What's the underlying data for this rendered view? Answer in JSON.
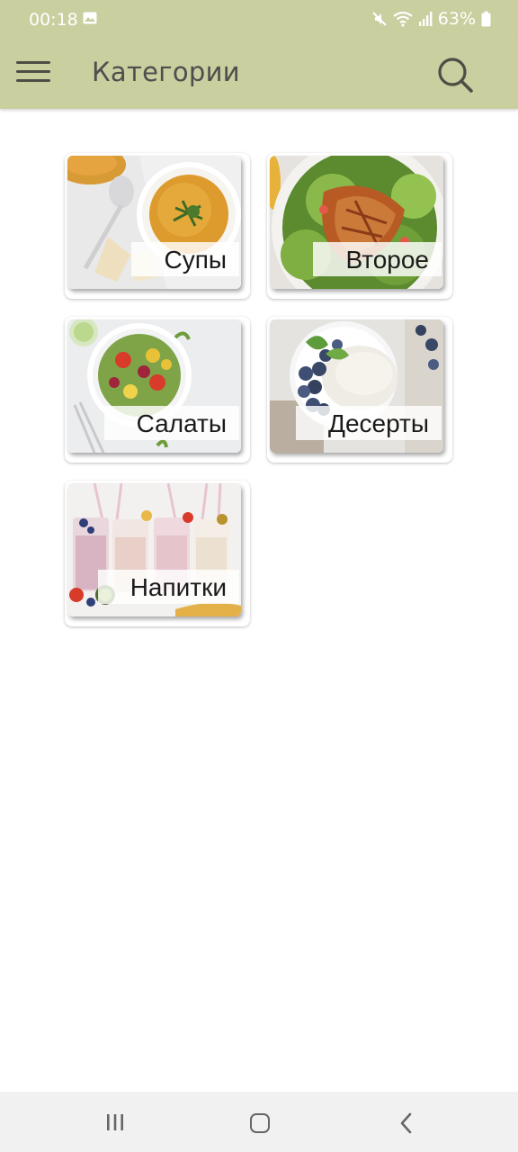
{
  "status_bar": {
    "time": "00:18",
    "battery": "63%",
    "icons": [
      "image-icon",
      "mute-icon",
      "wifi-icon",
      "signal-icon",
      "battery-icon"
    ]
  },
  "app_bar": {
    "title": "Категории",
    "menu_icon": "hamburger-menu-icon",
    "search_icon": "search-icon"
  },
  "categories": [
    {
      "label": "Супы",
      "image": "soup-photo"
    },
    {
      "label": "Второе",
      "image": "main-course-photo"
    },
    {
      "label": "Салаты",
      "image": "salad-photo"
    },
    {
      "label": "Десерты",
      "image": "dessert-photo"
    },
    {
      "label": "Напитки",
      "image": "drinks-photo"
    }
  ],
  "nav_bar": {
    "icons": [
      "recent-apps-icon",
      "home-icon",
      "back-icon"
    ]
  },
  "colors": {
    "app_bar": "#c9cf9f",
    "title_text": "#4e4e4e",
    "background": "#ffffff"
  }
}
